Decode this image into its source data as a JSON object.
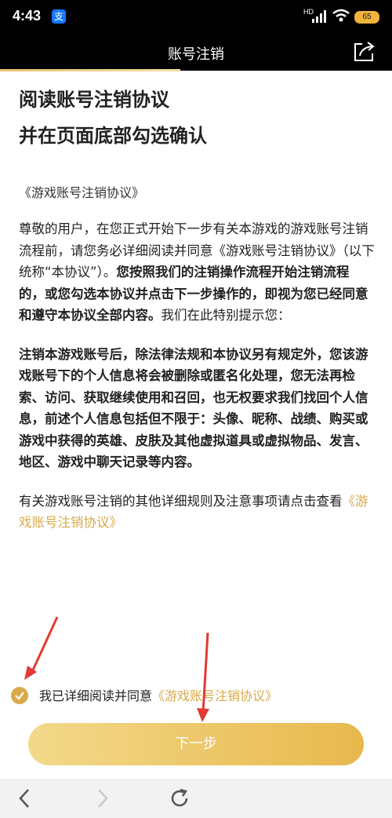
{
  "status": {
    "time": "4:43",
    "app_icon": "支",
    "network": "HD",
    "battery": "65"
  },
  "header": {
    "title": "账号注销"
  },
  "heading": {
    "line1": "阅读账号注销协议",
    "line2": "并在页面底部勾选确认"
  },
  "agreement": {
    "name": "《游戏账号注销协议》",
    "p1_normal": "尊敬的用户，在您正式开始下一步有关本游戏的游戏账号注销流程前，请您务必详细阅读并同意《游戏账号注销协议》（以下统称“本协议”）。",
    "p1_bold": "您按照我们的注销操作流程开始注销流程的，或您勾选本协议并点击下一步操作的，即视为您已经同意和遵守本协议全部内容。",
    "p1_tail": "我们在此特别提示您：",
    "p2_bold": "注销本游戏账号后，除法律法规和本协议另有规定外，您该游戏账号下的个人信息将会被删除或匿名化处理，您无法再检索、访问、获取继续使用和召回，也无权要求我们找回个人信息，前述个人信息包括但不限于：头像、昵称、战绩、购买或游戏中获得的英雄、皮肤及其他虚拟道具或虚拟物品、发言、地区、游戏中聊天记录等内容。",
    "p3_text": "有关游戏账号注销的其他详细规则及注意事项请点击查看",
    "p3_link": "《游戏账号注销协议》"
  },
  "consent": {
    "text": "我已详细阅读并同意",
    "link": "《游戏账号注销协议》",
    "checked": true
  },
  "next_button": {
    "label": "下一步"
  },
  "colors": {
    "accent": "#d9aa4a",
    "annotation": "#e53935"
  },
  "icons": {
    "share": "share-icon",
    "check": "check-icon",
    "back": "back-icon",
    "forward": "forward-icon",
    "refresh": "refresh-icon"
  }
}
